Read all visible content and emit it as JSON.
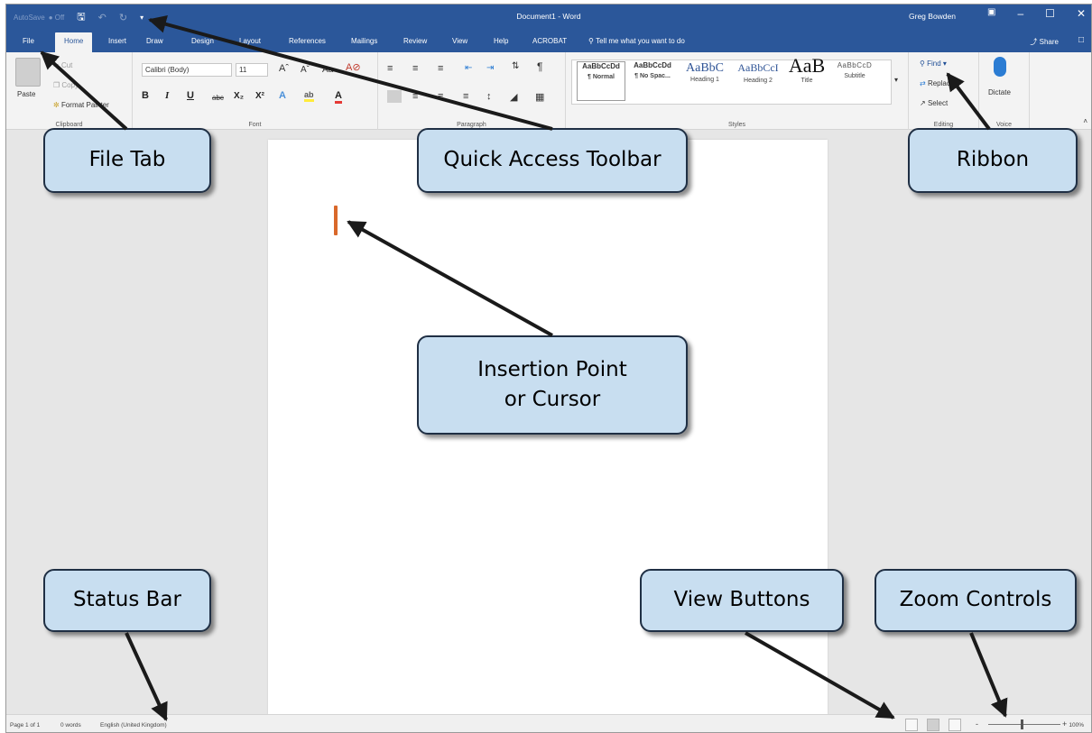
{
  "window": {
    "autosave": "AutoSave",
    "autosave_state": "● Off",
    "doc_title": "Document1  -  Word",
    "user": "Greg Bowden"
  },
  "tabs": [
    "File",
    "Home",
    "Insert",
    "Draw",
    "Design",
    "Layout",
    "References",
    "Mailings",
    "Review",
    "View",
    "Help",
    "ACROBAT"
  ],
  "tell_me": "Tell me what you want to do",
  "share": "Share",
  "ribbon": {
    "clipboard": {
      "paste": "Paste",
      "cut": "Cut",
      "copy": "Copy",
      "format_painter": "Format Painter",
      "label": "Clipboard"
    },
    "font": {
      "family": "Calibri (Body)",
      "size": "11",
      "label": "Font"
    },
    "paragraph": {
      "label": "Paragraph"
    },
    "styles": {
      "items": [
        {
          "sample": "AaBbCcDd",
          "name": "¶ Normal"
        },
        {
          "sample": "AaBbCcDd",
          "name": "¶ No Spac..."
        },
        {
          "sample": "AaBbC",
          "name": "Heading 1"
        },
        {
          "sample": "AaBbCcI",
          "name": "Heading 2"
        },
        {
          "sample": "AaB",
          "name": "Title"
        },
        {
          "sample": "AaBbCcD",
          "name": "Subtitle"
        }
      ],
      "label": "Styles"
    },
    "editing": {
      "find": "Find",
      "replace": "Replace",
      "select": "Select",
      "label": "Editing"
    },
    "voice": {
      "dictate": "Dictate",
      "label": "Voice"
    }
  },
  "status": {
    "page": "Page 1 of 1",
    "words": "0 words",
    "language": "English (United Kingdom)",
    "zoom": "100%"
  },
  "callouts": {
    "file_tab": "File Tab",
    "quick_access": "Quick Access Toolbar",
    "ribbon": "Ribbon",
    "insertion_line1": "Insertion Point",
    "insertion_line2": "or Cursor",
    "status_bar": "Status Bar",
    "view_buttons": "View Buttons",
    "zoom_controls": "Zoom Controls"
  },
  "colors": {
    "title_bar": "#2b579a",
    "callout_fill": "#c8def0",
    "cursor": "#d9682a"
  }
}
